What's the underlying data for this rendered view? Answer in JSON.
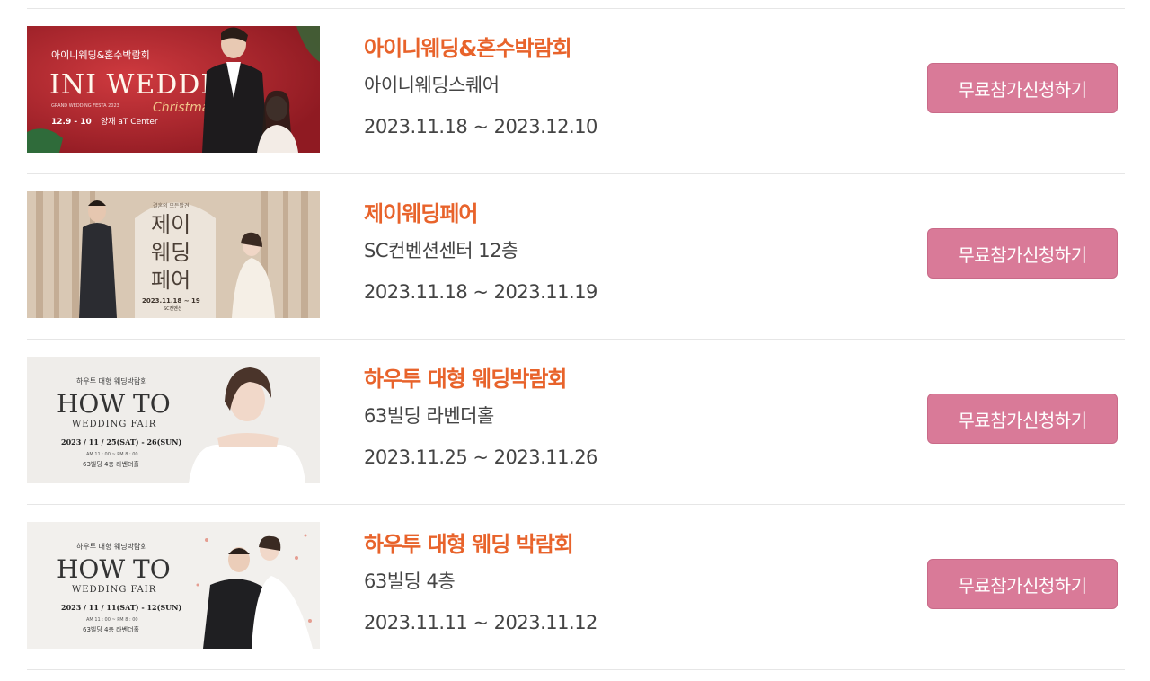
{
  "fairs": [
    {
      "title": "아이니웨딩&혼수박람회",
      "venue": "아이니웨딩스퀘어",
      "date": "2023.11.18 ~ 2023.12.10",
      "button": "무료참가신청하기",
      "poster": {
        "subtitle": "아이니웨딩&혼수박람회",
        "headline": "INI WEDDING",
        "script": "Christmas",
        "small": "GRAND WEDDING FESTA 2023",
        "dates": "12.9 - 10",
        "place": "양재 aT Center",
        "bg": "#b8262e"
      }
    },
    {
      "title": "제이웨딩페어",
      "venue": "SC컨벤션센터 12층",
      "date": "2023.11.18 ~ 2023.11.19",
      "button": "무료참가신청하기",
      "poster": {
        "tagline": "결혼의 모든발견",
        "line1": "제이",
        "line2": "웨딩",
        "line3": "페어",
        "dates": "2023.11.18 ~ 19",
        "place": "SC컨벤션",
        "bg": "#cdb8a2"
      }
    },
    {
      "title": "하우투 대형 웨딩박람회",
      "venue": "63빌딩 라벤더홀",
      "date": "2023.11.25 ~ 2023.11.26",
      "button": "무료참가신청하기",
      "poster": {
        "kicker": "하우투 대형 웨딩박람회",
        "headline": "HOW TO",
        "sub": "WEDDING FAIR",
        "dates": "2023 / 11 / 25(SAT) - 26(SUN)",
        "time": "AM 11 : 00 ~ PM 8 : 00",
        "place": "63빌딩 4층 라벤더홀",
        "bg": "#efedea"
      }
    },
    {
      "title": "하우투 대형 웨딩 박람회",
      "venue": "63빌딩 4층",
      "date": "2023.11.11 ~ 2023.11.12",
      "button": "무료참가신청하기",
      "poster": {
        "kicker": "하우투 대형 웨딩박람회",
        "headline": "HOW TO",
        "sub": "WEDDING FAIR",
        "dates": "2023 / 11 / 11(SAT) - 12(SUN)",
        "time": "AM 11 : 00 ~ PM 8 : 00",
        "place": "63빌딩 4층 라벤더홀",
        "bg": "#f2f0ed"
      }
    }
  ],
  "colors": {
    "title": "#e8632b",
    "button": "#d97a98",
    "text": "#444444",
    "divider": "#e6e6e6"
  }
}
